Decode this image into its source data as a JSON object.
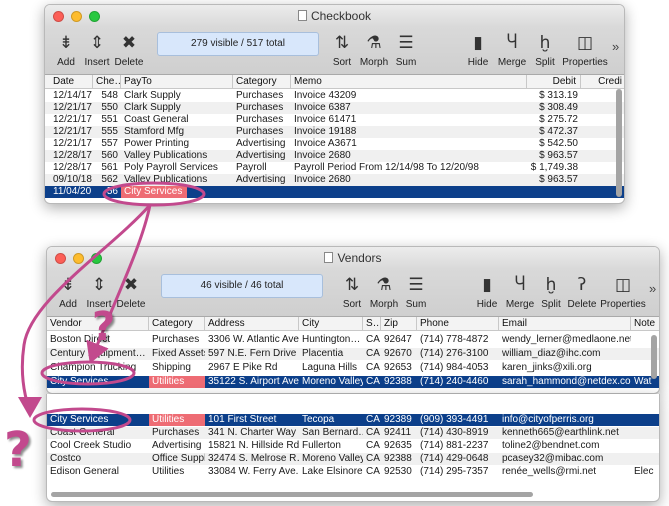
{
  "checkbook": {
    "title": "Checkbook",
    "status": "279 visible / 517 total",
    "toolbar": {
      "add": "Add",
      "insert": "Insert",
      "delete": "Delete",
      "sort": "Sort",
      "morph": "Morph",
      "sum": "Sum",
      "hide": "Hide",
      "merge": "Merge",
      "split": "Split",
      "properties": "Properties"
    },
    "columns": [
      "Date",
      "Che…",
      "PayTo",
      "Category",
      "Memo",
      "Debit",
      "Credi"
    ],
    "rows": [
      [
        "12/14/17",
        "548",
        "Clark Supply",
        "Purchases",
        "Invoice 43209",
        "$ 313.19"
      ],
      [
        "12/21/17",
        "550",
        "Clark Supply",
        "Purchases",
        "Invoice 6387",
        "$ 308.49"
      ],
      [
        "12/21/17",
        "551",
        "Coast General",
        "Purchases",
        "Invoice 61471",
        "$ 275.72"
      ],
      [
        "12/21/17",
        "555",
        "Stamford Mfg",
        "Purchases",
        "Invoice 19188",
        "$ 472.37"
      ],
      [
        "12/21/17",
        "557",
        "Power Printing",
        "Advertising",
        "Invoice A3671",
        "$ 542.50"
      ],
      [
        "12/28/17",
        "560",
        "Valley Publications",
        "Advertising",
        "Invoice 2680",
        "$ 963.57"
      ],
      [
        "12/28/17",
        "561",
        "Poly Payroll Services",
        "Payroll",
        "Payroll Period From 12/14/98 To 12/20/98",
        "$ 1,749.38"
      ],
      [
        "09/10/18",
        "562",
        "Valley Publications",
        "Advertising",
        "Invoice 2680",
        "$ 963.57"
      ],
      [
        "11/04/20",
        "56",
        "City Services",
        "",
        "",
        ""
      ]
    ]
  },
  "vendors": {
    "title": "Vendors",
    "status": "46 visible / 46 total",
    "toolbar": {
      "add": "Add",
      "insert": "Insert",
      "delete": "Delete",
      "sort": "Sort",
      "morph": "Morph",
      "sum": "Sum",
      "hide": "Hide",
      "merge": "Merge",
      "split": "Split",
      "delete2": "Delete",
      "properties": "Properties"
    },
    "columns": [
      "Vendor",
      "Category",
      "Address",
      "City",
      "S…",
      "Zip",
      "Phone",
      "Email",
      "Note"
    ],
    "rows_top": [
      [
        "Boston Direct",
        "Purchases",
        "3306 W. Atlantic Ave",
        "Huntington…",
        "CA",
        "92647",
        "(714) 778-4872",
        "wendy_lerner@medlaone.net",
        ""
      ],
      [
        "Century Equipment…",
        "Fixed Assets",
        "597 N.E. Fern Drive",
        "Placentia",
        "CA",
        "92670",
        "(714) 276-3100",
        "william_diaz@ihc.com",
        ""
      ],
      [
        "Champion Trucking",
        "Shipping",
        "2967 E Pike Rd",
        "Laguna Hills",
        "CA",
        "92653",
        "(714) 984-4053",
        "karen_jinks@xili.org",
        ""
      ],
      [
        "City Services",
        "Utilities",
        "35122 S. Airport Ave.",
        "Moreno Valley",
        "CA",
        "92388",
        "(714) 240-4460",
        "sarah_hammond@netdex.com",
        "Wat"
      ]
    ],
    "rows_bottom": [
      [
        "City Services",
        "Utilities",
        "101 First Street",
        "Tecopa",
        "CA",
        "92389",
        "(909) 393-4491",
        "info@cityofperris.org",
        ""
      ],
      [
        "Coast General",
        "Purchases",
        "341 N. Charter Way",
        "San Bernard…",
        "CA",
        "92411",
        "(714) 430-8919",
        "kenneth665@earthlink.net",
        ""
      ],
      [
        "Cool Creek Studio",
        "Advertising",
        "15821 N. Hillside Rd.",
        "Fullerton",
        "CA",
        "92635",
        "(714) 881-2237",
        "toline2@bendnet.com",
        ""
      ],
      [
        "Costco",
        "Office Supplies",
        "32474 S. Melrose R…",
        "Moreno Valley",
        "CA",
        "92388",
        "(714) 429-0648",
        "pcasey32@mibac.com",
        ""
      ],
      [
        "Edison General",
        "Utilities",
        "33084 W. Ferry Ave.",
        "Lake Elsinore",
        "CA",
        "92530",
        "(714) 295-7357",
        "renée_wells@rmi.net",
        "Elec"
      ]
    ]
  },
  "annotations": {
    "question_mark": "?"
  },
  "colors": {
    "selection": "#0c3f8a",
    "highlight": "#ee6c74",
    "annotation": "#c2498d",
    "status_bg": "#d8e7fb"
  },
  "icons": [
    "add-icon",
    "insert-icon",
    "delete-icon",
    "sort-icon",
    "morph-icon",
    "sum-icon",
    "hide-icon",
    "merge-icon",
    "split-icon",
    "properties-icon"
  ]
}
